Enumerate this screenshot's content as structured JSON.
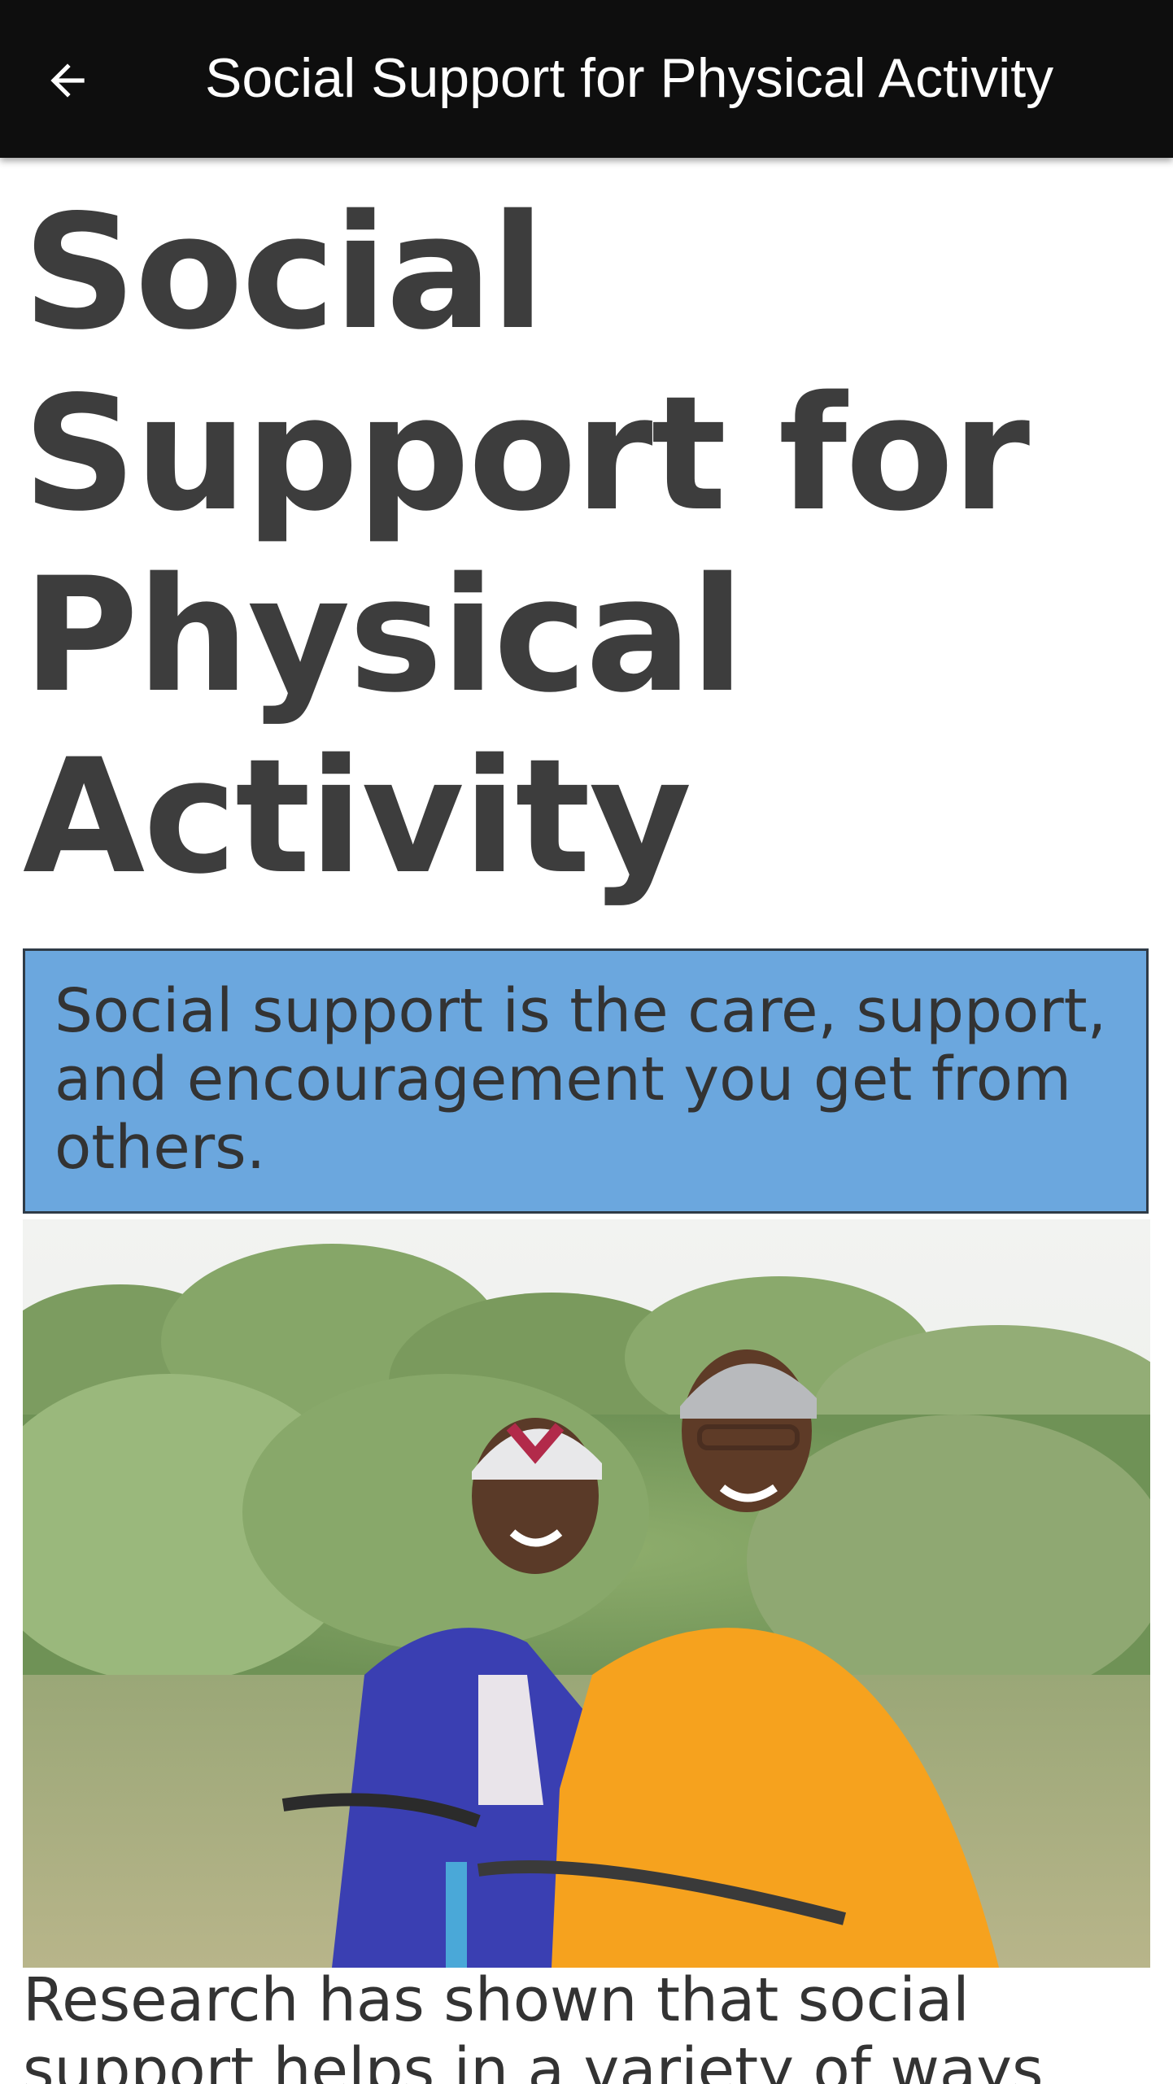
{
  "appbar": {
    "back_icon": "arrow-left-icon",
    "title": "Social Support for Physical Activity"
  },
  "article": {
    "heading": "Social Support for Physical Activity",
    "callout": "Social support is the care, support, and encouragement you get from others.",
    "image": "couple-on-bicycles-photo",
    "body_text": "Research has shown that social support helps in a variety of ways"
  },
  "colors": {
    "appbar_bg": "#0e0e0e",
    "heading": "#3d3d3d",
    "callout_bg": "#6ba7de",
    "callout_border": "#2f3b47",
    "text": "#333333"
  }
}
